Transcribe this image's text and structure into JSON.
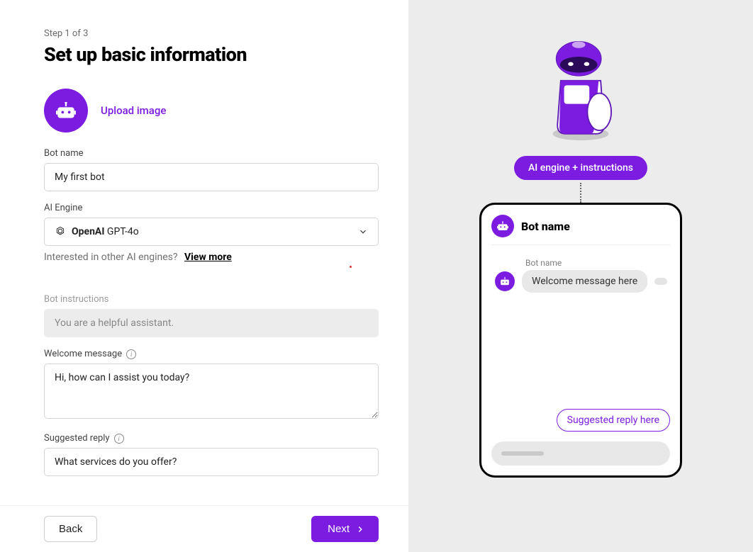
{
  "step": "Step 1 of 3",
  "title": "Set up basic information",
  "upload": {
    "link": "Upload image"
  },
  "form": {
    "bot_name": {
      "label": "Bot name",
      "value": "My first bot"
    },
    "ai_engine": {
      "label": "AI Engine",
      "brand": "OpenAI",
      "model": "GPT-4o",
      "hint": "Interested in other AI engines?",
      "view_more": "View more"
    },
    "instructions": {
      "label": "Bot instructions",
      "value": "You are a helpful assistant."
    },
    "welcome": {
      "label": "Welcome message",
      "value": "Hi, how can I assist you today?"
    },
    "suggested": {
      "label": "Suggested reply",
      "value": "What services do you offer?"
    }
  },
  "footer": {
    "back": "Back",
    "next": "Next"
  },
  "preview": {
    "pill": "AI engine + instructions",
    "header_title": "Bot name",
    "msg_name": "Bot name",
    "welcome_msg": "Welcome message here",
    "suggested_chip": "Suggested reply here"
  }
}
